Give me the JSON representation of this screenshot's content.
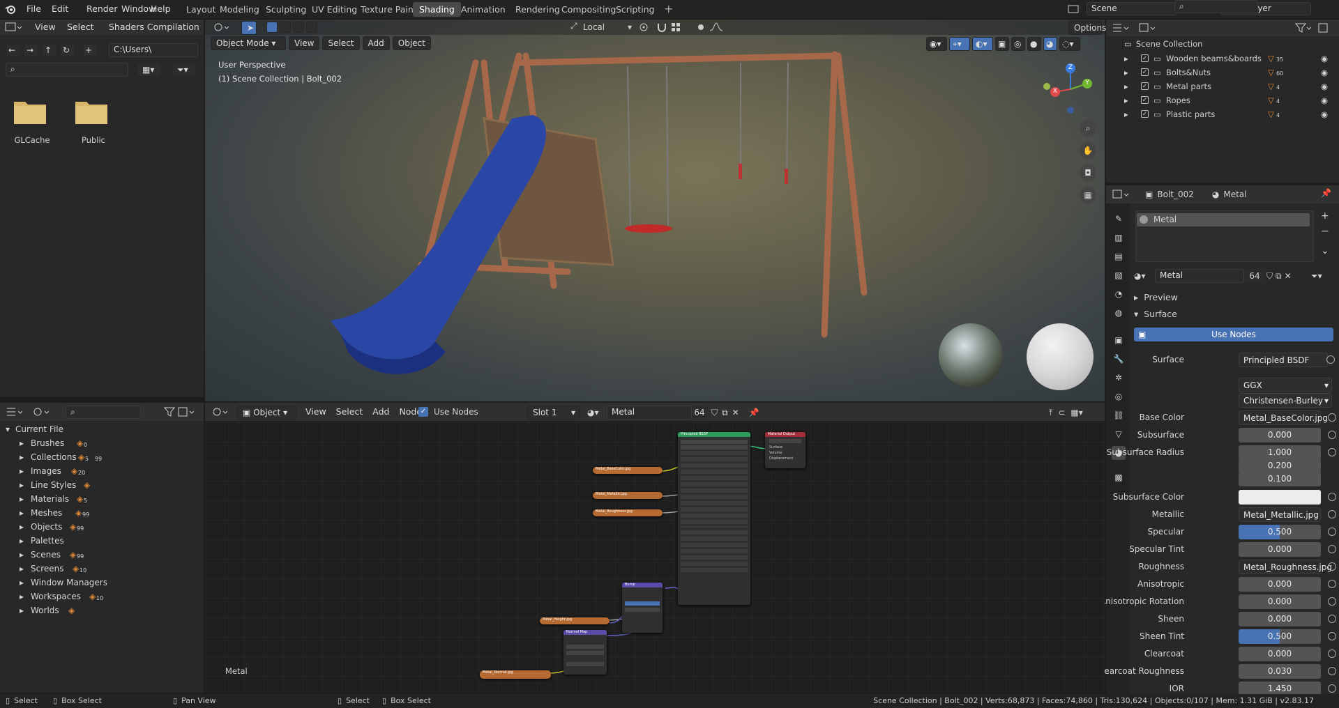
{
  "menu": [
    "File",
    "Edit",
    "Render",
    "Window",
    "Help"
  ],
  "workspaces": [
    "Layout",
    "Modeling",
    "Sculpting",
    "UV Editing",
    "Texture Paint",
    "Shading",
    "Animation",
    "Rendering",
    "Compositing",
    "Scripting"
  ],
  "active_workspace": "Shading",
  "scene": "Scene",
  "view_layer": "View Layer",
  "file_browser": {
    "menus": [
      "View",
      "Select",
      "Shaders Compilation"
    ],
    "path": "C:\\Users\\",
    "folders": [
      "GLCache",
      "Public"
    ]
  },
  "viewport": {
    "mode": "Object Mode",
    "menus": [
      "View",
      "Select",
      "Add",
      "Object"
    ],
    "transform_orientation": "Local",
    "perspective": "User Perspective",
    "collection_info": "(1) Scene Collection | Bolt_002",
    "options": "Options",
    "gizmo_axes": [
      "Z",
      "Y",
      "X"
    ]
  },
  "outliner": {
    "root": "Scene Collection",
    "items": [
      {
        "name": "Wooden beams&boards",
        "count": "35"
      },
      {
        "name": "Bolts&Nuts",
        "count": "60"
      },
      {
        "name": "Metal parts",
        "count": "4"
      },
      {
        "name": "Ropes",
        "count": "4"
      },
      {
        "name": "Plastic parts",
        "count": "4"
      }
    ]
  },
  "data_browser": {
    "root": "Current File",
    "items": [
      {
        "name": "Brushes",
        "count": "0"
      },
      {
        "name": "Collections",
        "count": "5",
        "count2": "99"
      },
      {
        "name": "Images",
        "count": "20"
      },
      {
        "name": "Line Styles",
        "count": ""
      },
      {
        "name": "Materials",
        "count": "5"
      },
      {
        "name": "Meshes",
        "count": "99"
      },
      {
        "name": "Objects",
        "count": "99"
      },
      {
        "name": "Palettes",
        "count": ""
      },
      {
        "name": "Scenes",
        "count": "99"
      },
      {
        "name": "Screens",
        "count": "10"
      },
      {
        "name": "Window Managers",
        "count": ""
      },
      {
        "name": "Workspaces",
        "count": "10"
      },
      {
        "name": "Worlds",
        "count": ""
      }
    ]
  },
  "node_editor": {
    "editor_mode": "Object",
    "menus": [
      "View",
      "Select",
      "Add",
      "Node"
    ],
    "use_nodes_label": "Use Nodes",
    "slot": "Slot 1",
    "material": "Metal",
    "users": "64",
    "material_label": "Metal",
    "nodes": {
      "bsdf_title": "Principled BSDF",
      "output_title": "Material Output",
      "bump_title": "Bump",
      "normal_map_title": "Normal Map",
      "base_color_tex": "Metal_BaseColor.jpg",
      "metallic_tex": "Metal_Metallic.jpg",
      "roughness_tex": "Metal_Roughness.jpg",
      "height_tex": "Metal_Height.jpg",
      "normal_tex": "Metal_Normal.jpg",
      "output_sockets": [
        "Surface",
        "Volume",
        "Displacement"
      ]
    }
  },
  "properties": {
    "object": "Bolt_002",
    "material_tab": "Metal",
    "slot_name": "Metal",
    "material_name": "Metal",
    "users": "64",
    "preview_label": "Preview",
    "surface_label": "Surface",
    "use_nodes": "Use Nodes",
    "surface_shader_label": "Surface",
    "surface_shader": "Principled BSDF",
    "distribution": "GGX",
    "subsurface_method": "Christensen-Burley",
    "rows": [
      {
        "label": "Base Color",
        "value": "Metal_BaseColor.jpg",
        "type": "link"
      },
      {
        "label": "Subsurface",
        "value": "0.000",
        "type": "num"
      },
      {
        "label": "Subsurface Radius",
        "value": "1.000",
        "type": "num"
      },
      {
        "label": "",
        "value": "0.200",
        "type": "num"
      },
      {
        "label": "",
        "value": "0.100",
        "type": "num"
      },
      {
        "label": "Subsurface Color",
        "value": "",
        "type": "color"
      },
      {
        "label": "Metallic",
        "value": "Metal_Metallic.jpg",
        "type": "link"
      },
      {
        "label": "Specular",
        "value": "0.500",
        "type": "slider"
      },
      {
        "label": "Specular Tint",
        "value": "0.000",
        "type": "num"
      },
      {
        "label": "Roughness",
        "value": "Metal_Roughness.jpg",
        "type": "link"
      },
      {
        "label": "Anisotropic",
        "value": "0.000",
        "type": "num"
      },
      {
        "label": "Anisotropic Rotation",
        "value": "0.000",
        "type": "num"
      },
      {
        "label": "Sheen",
        "value": "0.000",
        "type": "num"
      },
      {
        "label": "Sheen Tint",
        "value": "0.500",
        "type": "slider"
      },
      {
        "label": "Clearcoat",
        "value": "0.000",
        "type": "num"
      },
      {
        "label": "Clearcoat Roughness",
        "value": "0.030",
        "type": "num"
      },
      {
        "label": "IOR",
        "value": "1.450",
        "type": "num"
      }
    ]
  },
  "status": {
    "left": [
      {
        "icon": "mouse-left-icon",
        "label": "Select"
      },
      {
        "icon": "mouse-middle-icon",
        "label": "Box Select"
      },
      {
        "icon": "mouse-right-icon",
        "label": "Pan View"
      },
      {
        "icon": "mouse-left-icon",
        "label": "Select"
      },
      {
        "icon": "mouse-middle-icon",
        "label": "Box Select"
      }
    ],
    "right": "Scene Collection | Bolt_002 | Verts:68,873 | Faces:74,860 | Tris:130,624 | Objects:0/107 | Mem: 1.31 GiB | v2.83.17"
  },
  "colors": {
    "accent": "#4772b3",
    "texture_node": "#b56a31",
    "bsdf_header": "#2a9a5a",
    "output_header": "#a42c3a",
    "vector_header": "#5b4ba8"
  }
}
